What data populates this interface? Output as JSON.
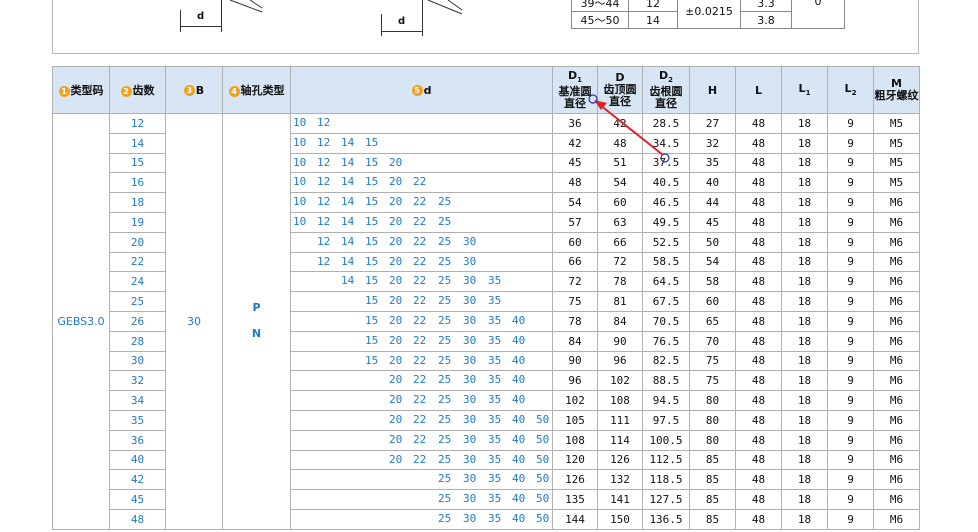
{
  "top": {
    "dim_label": "d",
    "mini_rows": [
      [
        "39～44",
        "12",
        "±0.0215",
        "3.3",
        "0"
      ],
      [
        "45～50",
        "14",
        "",
        "3.8",
        ""
      ]
    ]
  },
  "headers": {
    "type_code": {
      "n": "1",
      "label": "类型码"
    },
    "teeth": {
      "n": "2",
      "label": "齿数"
    },
    "b": {
      "n": "3",
      "label": "B"
    },
    "hole": {
      "n": "4",
      "label": "轴孔类型"
    },
    "d": {
      "n": "5",
      "label": "d"
    },
    "D1": {
      "sym": "D",
      "sub": "1",
      "l1": "基准圆",
      "l2": "直径"
    },
    "D": {
      "sym": "D",
      "l1": "齿顶圆",
      "l2": "直径"
    },
    "D2": {
      "sym": "D",
      "sub": "2",
      "l1": "齿根圆",
      "l2": "直径"
    },
    "H": "H",
    "L": "L",
    "L1": {
      "sym": "L",
      "sub": "1"
    },
    "L2": {
      "sym": "L",
      "sub": "2"
    },
    "M": {
      "sym": "M",
      "l1": "粗牙螺纹"
    }
  },
  "merged": {
    "type_code": "GEBS3.0",
    "b": "30",
    "hole_p": "P",
    "hole_n": "N"
  },
  "d_columns": [
    "10",
    "12",
    "14",
    "15",
    "20",
    "22",
    "25",
    "30",
    "35",
    "40",
    "50"
  ],
  "rows": [
    {
      "z": "12",
      "d": [
        "10",
        "12",
        "",
        "",
        "",
        "",
        "",
        "",
        "",
        "",
        ""
      ],
      "D1": "36",
      "D": "42",
      "D2": "28.5",
      "H": "27",
      "L": "48",
      "L1": "18",
      "L2": "9",
      "M": "M5"
    },
    {
      "z": "14",
      "d": [
        "10",
        "12",
        "14",
        "15",
        "",
        "",
        "",
        "",
        "",
        "",
        ""
      ],
      "D1": "42",
      "D": "48",
      "D2": "34.5",
      "H": "32",
      "L": "48",
      "L1": "18",
      "L2": "9",
      "M": "M5"
    },
    {
      "z": "15",
      "d": [
        "10",
        "12",
        "14",
        "15",
        "20",
        "",
        "",
        "",
        "",
        "",
        ""
      ],
      "D1": "45",
      "D": "51",
      "D2": "37.5",
      "H": "35",
      "L": "48",
      "L1": "18",
      "L2": "9",
      "M": "M5"
    },
    {
      "z": "16",
      "d": [
        "10",
        "12",
        "14",
        "15",
        "20",
        "22",
        "",
        "",
        "",
        "",
        ""
      ],
      "D1": "48",
      "D": "54",
      "D2": "40.5",
      "H": "40",
      "L": "48",
      "L1": "18",
      "L2": "9",
      "M": "M5"
    },
    {
      "z": "18",
      "d": [
        "10",
        "12",
        "14",
        "15",
        "20",
        "22",
        "25",
        "",
        "",
        "",
        ""
      ],
      "D1": "54",
      "D": "60",
      "D2": "46.5",
      "H": "44",
      "L": "48",
      "L1": "18",
      "L2": "9",
      "M": "M6"
    },
    {
      "z": "19",
      "d": [
        "10",
        "12",
        "14",
        "15",
        "20",
        "22",
        "25",
        "",
        "",
        "",
        ""
      ],
      "D1": "57",
      "D": "63",
      "D2": "49.5",
      "H": "45",
      "L": "48",
      "L1": "18",
      "L2": "9",
      "M": "M6"
    },
    {
      "z": "20",
      "d": [
        "",
        "12",
        "14",
        "15",
        "20",
        "22",
        "25",
        "30",
        "",
        "",
        ""
      ],
      "D1": "60",
      "D": "66",
      "D2": "52.5",
      "H": "50",
      "L": "48",
      "L1": "18",
      "L2": "9",
      "M": "M6"
    },
    {
      "z": "22",
      "d": [
        "",
        "12",
        "14",
        "15",
        "20",
        "22",
        "25",
        "30",
        "",
        "",
        ""
      ],
      "D1": "66",
      "D": "72",
      "D2": "58.5",
      "H": "54",
      "L": "48",
      "L1": "18",
      "L2": "9",
      "M": "M6"
    },
    {
      "z": "24",
      "d": [
        "",
        "",
        "14",
        "15",
        "20",
        "22",
        "25",
        "30",
        "35",
        "",
        ""
      ],
      "D1": "72",
      "D": "78",
      "D2": "64.5",
      "H": "58",
      "L": "48",
      "L1": "18",
      "L2": "9",
      "M": "M6"
    },
    {
      "z": "25",
      "d": [
        "",
        "",
        "",
        "15",
        "20",
        "22",
        "25",
        "30",
        "35",
        "",
        ""
      ],
      "D1": "75",
      "D": "81",
      "D2": "67.5",
      "H": "60",
      "L": "48",
      "L1": "18",
      "L2": "9",
      "M": "M6"
    },
    {
      "z": "26",
      "d": [
        "",
        "",
        "",
        "15",
        "20",
        "22",
        "25",
        "30",
        "35",
        "40",
        ""
      ],
      "D1": "78",
      "D": "84",
      "D2": "70.5",
      "H": "65",
      "L": "48",
      "L1": "18",
      "L2": "9",
      "M": "M6"
    },
    {
      "z": "28",
      "d": [
        "",
        "",
        "",
        "15",
        "20",
        "22",
        "25",
        "30",
        "35",
        "40",
        ""
      ],
      "D1": "84",
      "D": "90",
      "D2": "76.5",
      "H": "70",
      "L": "48",
      "L1": "18",
      "L2": "9",
      "M": "M6"
    },
    {
      "z": "30",
      "d": [
        "",
        "",
        "",
        "15",
        "20",
        "22",
        "25",
        "30",
        "35",
        "40",
        ""
      ],
      "D1": "90",
      "D": "96",
      "D2": "82.5",
      "H": "75",
      "L": "48",
      "L1": "18",
      "L2": "9",
      "M": "M6"
    },
    {
      "z": "32",
      "d": [
        "",
        "",
        "",
        "",
        "20",
        "22",
        "25",
        "30",
        "35",
        "40",
        ""
      ],
      "D1": "96",
      "D": "102",
      "D2": "88.5",
      "H": "75",
      "L": "48",
      "L1": "18",
      "L2": "9",
      "M": "M6"
    },
    {
      "z": "34",
      "d": [
        "",
        "",
        "",
        "",
        "20",
        "22",
        "25",
        "30",
        "35",
        "40",
        ""
      ],
      "D1": "102",
      "D": "108",
      "D2": "94.5",
      "H": "80",
      "L": "48",
      "L1": "18",
      "L2": "9",
      "M": "M6"
    },
    {
      "z": "35",
      "d": [
        "",
        "",
        "",
        "",
        "20",
        "22",
        "25",
        "30",
        "35",
        "40",
        "50"
      ],
      "D1": "105",
      "D": "111",
      "D2": "97.5",
      "H": "80",
      "L": "48",
      "L1": "18",
      "L2": "9",
      "M": "M6"
    },
    {
      "z": "36",
      "d": [
        "",
        "",
        "",
        "",
        "20",
        "22",
        "25",
        "30",
        "35",
        "40",
        "50"
      ],
      "D1": "108",
      "D": "114",
      "D2": "100.5",
      "H": "80",
      "L": "48",
      "L1": "18",
      "L2": "9",
      "M": "M6"
    },
    {
      "z": "40",
      "d": [
        "",
        "",
        "",
        "",
        "20",
        "22",
        "25",
        "30",
        "35",
        "40",
        "50"
      ],
      "D1": "120",
      "D": "126",
      "D2": "112.5",
      "H": "85",
      "L": "48",
      "L1": "18",
      "L2": "9",
      "M": "M6"
    },
    {
      "z": "42",
      "d": [
        "",
        "",
        "",
        "",
        "",
        "",
        "25",
        "30",
        "35",
        "40",
        "50"
      ],
      "D1": "126",
      "D": "132",
      "D2": "118.5",
      "H": "85",
      "L": "48",
      "L1": "18",
      "L2": "9",
      "M": "M6"
    },
    {
      "z": "45",
      "d": [
        "",
        "",
        "",
        "",
        "",
        "",
        "25",
        "30",
        "35",
        "40",
        "50"
      ],
      "D1": "135",
      "D": "141",
      "D2": "127.5",
      "H": "85",
      "L": "48",
      "L1": "18",
      "L2": "9",
      "M": "M6"
    },
    {
      "z": "48",
      "d": [
        "",
        "",
        "",
        "",
        "",
        "",
        "25",
        "30",
        "35",
        "40",
        "50"
      ],
      "D1": "144",
      "D": "150",
      "D2": "136.5",
      "H": "85",
      "L": "48",
      "L1": "18",
      "L2": "9",
      "M": "M6"
    }
  ]
}
